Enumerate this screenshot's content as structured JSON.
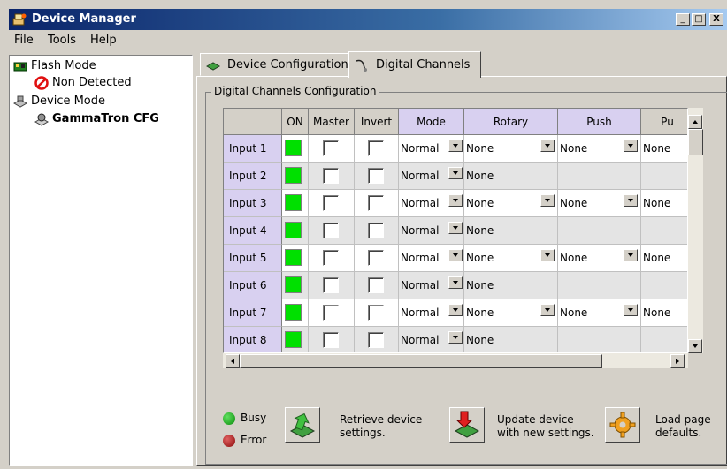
{
  "window": {
    "title": "Device Manager",
    "min": "_",
    "max": "□",
    "close": "X"
  },
  "menu": [
    "File",
    "Tools",
    "Help"
  ],
  "tree": [
    {
      "label": "Flash Mode",
      "icon": "flash-board-icon"
    },
    {
      "label": "Non Detected",
      "icon": "no-entry-icon"
    },
    {
      "label": "Device Mode",
      "icon": "device-icon"
    },
    {
      "label": "GammaTron CFG",
      "icon": "gammatron-device-icon"
    }
  ],
  "tabs": [
    {
      "label": "Device Configuration",
      "active": false
    },
    {
      "label": "Digital Channels",
      "active": true
    }
  ],
  "group_title": "Digital Channels Configuration",
  "grid": {
    "columns": [
      "ON",
      "Master",
      "Invert",
      "Mode",
      "Rotary",
      "Push",
      "Pu"
    ],
    "rows": [
      {
        "label": "Input 1",
        "mode": "Normal",
        "rotary": "None",
        "push": "None",
        "pu": "None"
      },
      {
        "label": "Input 2",
        "mode": "Normal",
        "rotary": "None",
        "push": "",
        "pu": ""
      },
      {
        "label": "Input 3",
        "mode": "Normal",
        "rotary": "None",
        "push": "None",
        "pu": "None"
      },
      {
        "label": "Input 4",
        "mode": "Normal",
        "rotary": "None",
        "push": "",
        "pu": ""
      },
      {
        "label": "Input 5",
        "mode": "Normal",
        "rotary": "None",
        "push": "None",
        "pu": "None"
      },
      {
        "label": "Input 6",
        "mode": "Normal",
        "rotary": "None",
        "push": "",
        "pu": ""
      },
      {
        "label": "Input 7",
        "mode": "Normal",
        "rotary": "None",
        "push": "None",
        "pu": "None"
      },
      {
        "label": "Input 8",
        "mode": "Normal",
        "rotary": "None",
        "push": "",
        "pu": ""
      }
    ]
  },
  "status": {
    "busy": "Busy",
    "error": "Error",
    "busy_color": "#0a8a0a",
    "error_color": "#8a0a0a",
    "on_color": "#00e000"
  },
  "actions": {
    "retrieve": "Retrieve device settings.",
    "update": "Update device with new settings.",
    "load": "Load page defaults."
  }
}
